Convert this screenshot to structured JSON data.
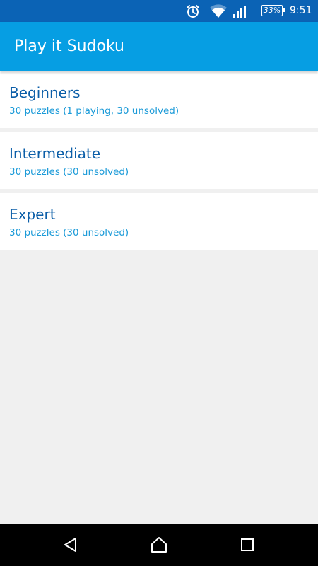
{
  "status_bar": {
    "battery": "33%",
    "time": "9:51",
    "icons": [
      "alarm-icon",
      "wifi-icon",
      "signal-icon",
      "battery-icon"
    ]
  },
  "app_bar": {
    "title": "Play it Sudoku"
  },
  "levels": [
    {
      "title": "Beginners",
      "subtitle": "30 puzzles (1 playing, 30 unsolved)"
    },
    {
      "title": "Intermediate",
      "subtitle": "30 puzzles (30 unsolved)"
    },
    {
      "title": "Expert",
      "subtitle": "30 puzzles (30 unsolved)"
    }
  ],
  "nav_bar": {
    "icons": [
      "back-icon",
      "home-icon",
      "recents-icon"
    ]
  },
  "colors": {
    "status_bar": "#0b63b5",
    "app_bar": "#069ee3",
    "title_text": "#0b5ea8",
    "subtitle_text": "#1a9ad8",
    "background": "#f0f0f0"
  }
}
